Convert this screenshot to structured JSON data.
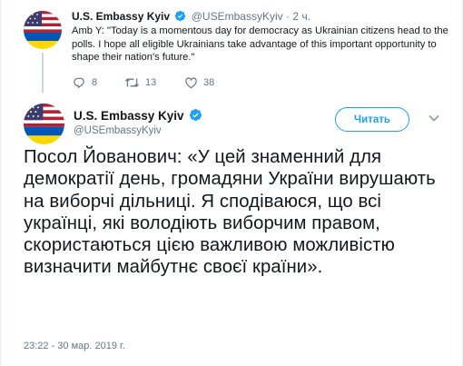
{
  "parent_tweet": {
    "author_name": "U.S. Embassy Kyiv",
    "author_handle": "@USEmbassyKyiv",
    "separator": "·",
    "time_ago": "2 ч.",
    "text": "Amb Y: \"Today is a momentous day for democracy as Ukrainian citizens head to the polls. I hope all eligible Ukrainians take advantage of this important opportunity to shape their nation's future.\"",
    "replies": "8",
    "retweets": "13",
    "likes": "38",
    "icons": [
      "verified-badge-icon",
      "reply-icon",
      "retweet-icon",
      "like-icon"
    ]
  },
  "main_tweet": {
    "author_name": "U.S. Embassy Kyiv",
    "author_handle": "@USEmbassyKyiv",
    "follow_label": "Читать",
    "text": "Посол Йованович: «У цей знаменний для демократії день, громадяни України вирушають на виборчі дільниці. Я сподіваюся, що всі українці, які володіють виборчим правом, скористаються цією важливою можливістю визначити майбутнє своєї країни».",
    "timestamp": "23:22 - 30 мар. 2019 г.",
    "icons": [
      "verified-badge-icon",
      "chevron-down-icon"
    ]
  },
  "colors": {
    "accent": "#1da1f2",
    "text": "#14171a",
    "muted": "#657786",
    "thread_line": "#ccd6dd",
    "flag_blue": "#3c3b6e",
    "flag_red": "#b22234",
    "ua_blue": "#0057b7",
    "ua_yellow": "#ffd700"
  }
}
